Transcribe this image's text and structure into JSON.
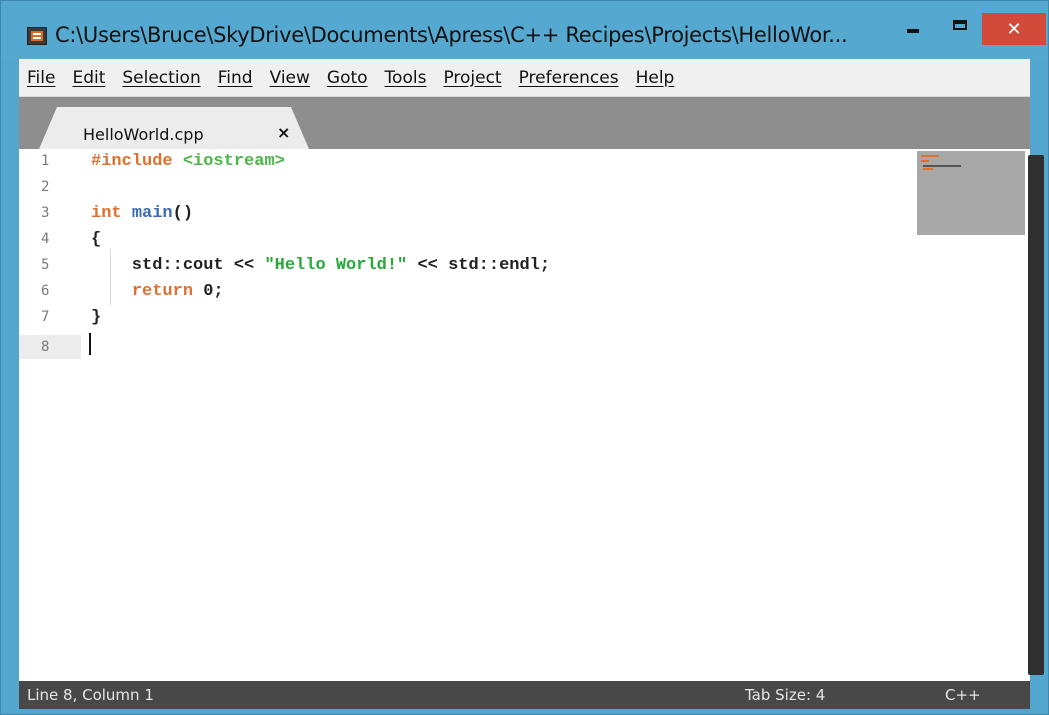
{
  "window": {
    "title": "C:\\Users\\Bruce\\SkyDrive\\Documents\\Apress\\C++ Recipes\\Projects\\HelloWor...",
    "close_glyph": "✕"
  },
  "menu": {
    "items": [
      "File",
      "Edit",
      "Selection",
      "Find",
      "View",
      "Goto",
      "Tools",
      "Project",
      "Preferences",
      "Help"
    ]
  },
  "tab": {
    "label": "HelloWorld.cpp",
    "close_glyph": "×"
  },
  "editor": {
    "line_numbers": [
      "1",
      "2",
      "3",
      "4",
      "5",
      "6",
      "7",
      "8"
    ],
    "lines": [
      [
        {
          "t": "#include",
          "c": "pre"
        },
        {
          "t": " ",
          "c": ""
        },
        {
          "t": "<iostream>",
          "c": "inc"
        }
      ],
      [],
      [
        {
          "t": "int",
          "c": "kw"
        },
        {
          "t": " ",
          "c": ""
        },
        {
          "t": "main",
          "c": "fn"
        },
        {
          "t": "()",
          "c": ""
        }
      ],
      [
        {
          "t": "{",
          "c": ""
        }
      ],
      [
        {
          "t": "    std::cout << ",
          "c": ""
        },
        {
          "t": "\"Hello World!\"",
          "c": "str"
        },
        {
          "t": " << std::endl;",
          "c": ""
        }
      ],
      [
        {
          "t": "    ",
          "c": ""
        },
        {
          "t": "return",
          "c": "kw"
        },
        {
          "t": " 0;",
          "c": "num"
        }
      ],
      [
        {
          "t": "}",
          "c": ""
        }
      ],
      []
    ],
    "current_line": 8,
    "colors": {
      "preprocessor": "#e0702f",
      "include": "#4db64a",
      "keyword": "#e0702f",
      "function": "#3d6bb3",
      "string": "#27a83a"
    }
  },
  "status": {
    "position": "Line 8, Column 1",
    "tab_size": "Tab Size: 4",
    "language": "C++"
  }
}
